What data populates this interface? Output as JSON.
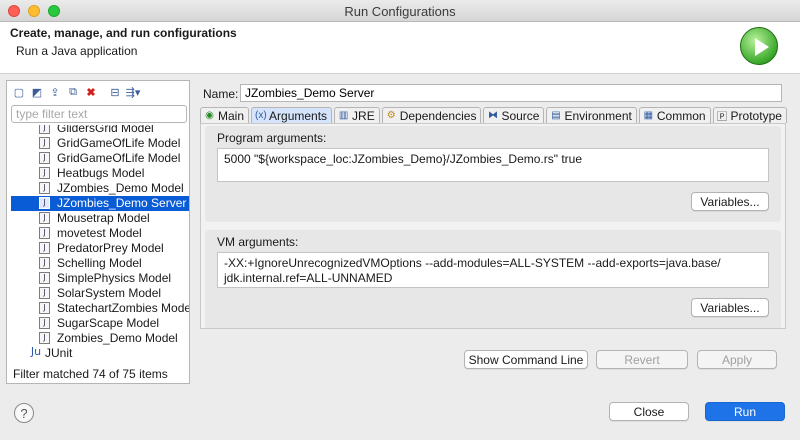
{
  "window": {
    "title": "Run Configurations"
  },
  "header": {
    "title": "Create, manage, and run configurations",
    "subtitle": "Run a Java application",
    "icon": "run-play-icon"
  },
  "left_panel": {
    "toolbar_icons": [
      "new-config-icon",
      "new-prototype-icon",
      "export-icon",
      "duplicate-icon",
      "delete-icon",
      "collapse-all-icon",
      "filter-menu-icon"
    ],
    "filter_placeholder": "type filter text",
    "tree_items": [
      {
        "label": "GlidersGrid Model",
        "selected": false
      },
      {
        "label": "GridGameOfLife Model",
        "selected": false
      },
      {
        "label": "GridGameOfLife Model",
        "selected": false
      },
      {
        "label": "Heatbugs Model",
        "selected": false
      },
      {
        "label": "JZombies_Demo Model",
        "selected": false
      },
      {
        "label": "JZombies_Demo Server",
        "selected": true
      },
      {
        "label": "Mousetrap Model",
        "selected": false
      },
      {
        "label": "movetest Model",
        "selected": false
      },
      {
        "label": "PredatorPrey Model",
        "selected": false
      },
      {
        "label": "Schelling Model",
        "selected": false
      },
      {
        "label": "SimplePhysics Model",
        "selected": false
      },
      {
        "label": "SolarSystem Model",
        "selected": false
      },
      {
        "label": "StatechartZombies Model",
        "selected": false
      },
      {
        "label": "SugarScape Model",
        "selected": false
      },
      {
        "label": "Zombies_Demo Model",
        "selected": false
      }
    ],
    "junit_label": "JUnit",
    "filter_status": "Filter matched 74 of 75 items"
  },
  "right_panel": {
    "name_label": "Name:",
    "name_value": "JZombies_Demo Server",
    "tabs": [
      {
        "label": "Main",
        "icon": "main-icon",
        "active": false
      },
      {
        "label": "Arguments",
        "icon": "arguments-icon",
        "active": true
      },
      {
        "label": "JRE",
        "icon": "jre-icon",
        "active": false
      },
      {
        "label": "Dependencies",
        "icon": "dependencies-icon",
        "active": false
      },
      {
        "label": "Source",
        "icon": "source-icon",
        "active": false
      },
      {
        "label": "Environment",
        "icon": "environment-icon",
        "active": false
      },
      {
        "label": "Common",
        "icon": "common-icon",
        "active": false
      },
      {
        "label": "Prototype",
        "icon": "prototype-icon",
        "active": false
      }
    ],
    "program_args": {
      "label": "Program arguments:",
      "value": "5000 \"${workspace_loc:JZombies_Demo}/JZombies_Demo.rs\" true",
      "variables_button": "Variables..."
    },
    "vm_args": {
      "label": "VM arguments:",
      "line1": "-XX:+IgnoreUnrecognizedVMOptions --add-modules=ALL-SYSTEM --add-exports=java.base/",
      "line2": "jdk.internal.ref=ALL-UNNAMED",
      "variables_button": "Variables..."
    },
    "buttons": {
      "show_command_line": "Show Command Line",
      "revert": "Revert",
      "apply": "Apply"
    }
  },
  "footer": {
    "help_icon": "?",
    "close": "Close",
    "run": "Run"
  },
  "colors": {
    "selection": "#0a5bd6",
    "primary_button": "#1e73e8",
    "run_icon": "#3aa82a"
  }
}
